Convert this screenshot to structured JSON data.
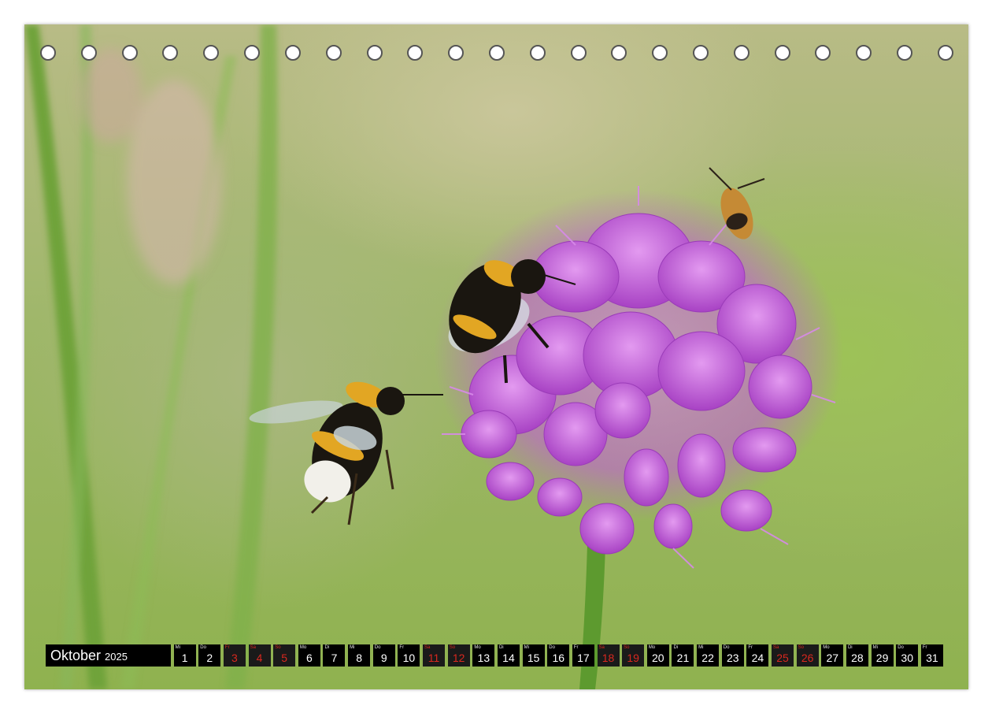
{
  "calendar": {
    "month": "Oktober",
    "year": "2025",
    "days": [
      {
        "wd": "Mi",
        "n": "1",
        "weekend": false
      },
      {
        "wd": "Do",
        "n": "2",
        "weekend": false
      },
      {
        "wd": "Fr",
        "n": "3",
        "weekend": true
      },
      {
        "wd": "Sa",
        "n": "4",
        "weekend": true
      },
      {
        "wd": "So",
        "n": "5",
        "weekend": true
      },
      {
        "wd": "Mo",
        "n": "6",
        "weekend": false
      },
      {
        "wd": "Di",
        "n": "7",
        "weekend": false
      },
      {
        "wd": "Mi",
        "n": "8",
        "weekend": false
      },
      {
        "wd": "Do",
        "n": "9",
        "weekend": false
      },
      {
        "wd": "Fr",
        "n": "10",
        "weekend": false
      },
      {
        "wd": "Sa",
        "n": "11",
        "weekend": true
      },
      {
        "wd": "So",
        "n": "12",
        "weekend": true
      },
      {
        "wd": "Mo",
        "n": "13",
        "weekend": false
      },
      {
        "wd": "Di",
        "n": "14",
        "weekend": false
      },
      {
        "wd": "Mi",
        "n": "15",
        "weekend": false
      },
      {
        "wd": "Do",
        "n": "16",
        "weekend": false
      },
      {
        "wd": "Fr",
        "n": "17",
        "weekend": false
      },
      {
        "wd": "Sa",
        "n": "18",
        "weekend": true
      },
      {
        "wd": "So",
        "n": "19",
        "weekend": true
      },
      {
        "wd": "Mo",
        "n": "20",
        "weekend": false
      },
      {
        "wd": "Di",
        "n": "21",
        "weekend": false
      },
      {
        "wd": "Mi",
        "n": "22",
        "weekend": false
      },
      {
        "wd": "Do",
        "n": "23",
        "weekend": false
      },
      {
        "wd": "Fr",
        "n": "24",
        "weekend": false
      },
      {
        "wd": "Sa",
        "n": "25",
        "weekend": true
      },
      {
        "wd": "So",
        "n": "26",
        "weekend": true
      },
      {
        "wd": "Mo",
        "n": "27",
        "weekend": false
      },
      {
        "wd": "Di",
        "n": "28",
        "weekend": false
      },
      {
        "wd": "Mi",
        "n": "29",
        "weekend": false
      },
      {
        "wd": "Do",
        "n": "30",
        "weekend": false
      },
      {
        "wd": "Fr",
        "n": "31",
        "weekend": false
      }
    ]
  },
  "colors": {
    "flower": "#c45fd6",
    "background_green": "#9dbf5a",
    "bee_stripe": "#e2a623",
    "weekend_text": "#d9281f"
  }
}
